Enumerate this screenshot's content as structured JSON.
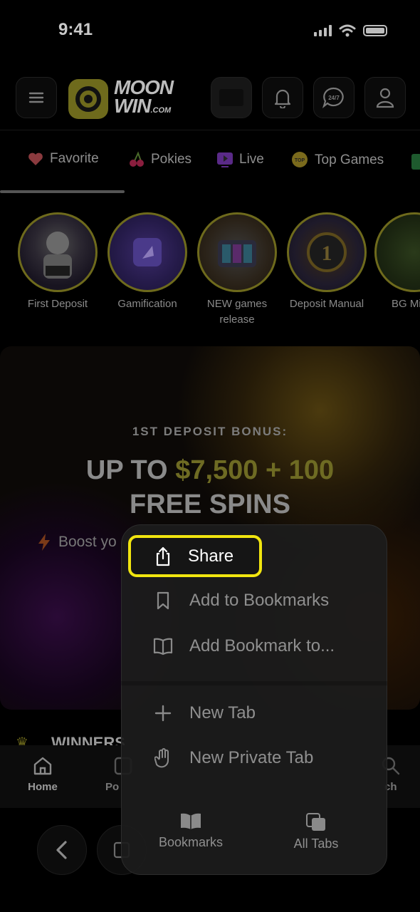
{
  "status": {
    "time": "9:41"
  },
  "header": {
    "logo": {
      "line1": "MOON",
      "line2": "WIN",
      "suffix": ".COM"
    }
  },
  "tabs": [
    {
      "label": "Favorite",
      "icon": "heart-icon"
    },
    {
      "label": "Pokies",
      "icon": "cherries-icon"
    },
    {
      "label": "Live",
      "icon": "live-play-icon"
    },
    {
      "label": "Top Games",
      "icon": "top-badge-icon"
    }
  ],
  "stories": [
    {
      "label": "First Deposit"
    },
    {
      "label": "Gamification"
    },
    {
      "label": "NEW games release"
    },
    {
      "label": "Deposit Manual"
    },
    {
      "label": "BG Millio"
    }
  ],
  "banner": {
    "subtitle": "1ST DEPOSIT BONUS:",
    "title_prefix": "UP TO ",
    "title_highlight": "$7,500 + 100",
    "title_line2": "FREE SPINS",
    "boost_text": "Boost yo"
  },
  "winners": {
    "label": "WINNERS"
  },
  "bottom_nav": [
    {
      "label": "Home",
      "icon": "home-icon"
    },
    {
      "label": "Po",
      "icon": "pokies-icon"
    },
    {
      "label": "ch",
      "icon": "search-icon"
    }
  ],
  "context_menu": {
    "items": [
      {
        "label": "Share",
        "icon": "share-icon"
      },
      {
        "label": "Add to Bookmarks",
        "icon": "bookmark-icon"
      },
      {
        "label": "Add Bookmark to...",
        "icon": "open-book-icon"
      },
      {
        "label": "New Tab",
        "icon": "plus-icon"
      },
      {
        "label": "New Private Tab",
        "icon": "hand-icon"
      }
    ],
    "bottom": [
      {
        "label": "Bookmarks",
        "icon": "bookmarks-book-icon"
      },
      {
        "label": "All Tabs",
        "icon": "tabs-icon"
      }
    ]
  },
  "colors": {
    "highlight": "#f1e50f",
    "brand": "#d8d000"
  }
}
